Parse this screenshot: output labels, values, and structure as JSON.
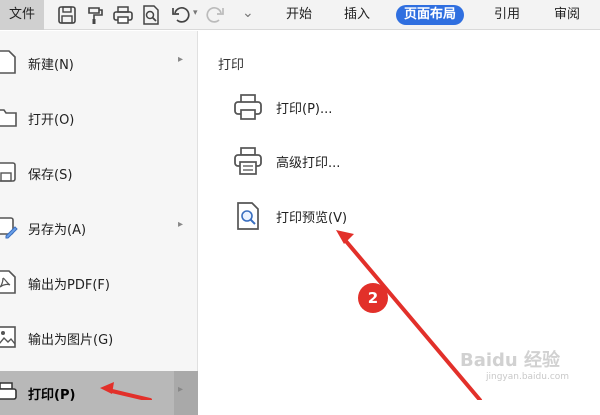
{
  "toolbar": {
    "file_menu_label": "文件",
    "tabs": [
      {
        "label": "开始",
        "active": false
      },
      {
        "label": "插入",
        "active": false
      },
      {
        "label": "页面布局",
        "active": true
      },
      {
        "label": "引用",
        "active": false
      },
      {
        "label": "审阅",
        "active": false
      }
    ],
    "quick_icons": [
      "save-icon",
      "format-painter-icon",
      "print-icon",
      "print-preview-icon",
      "undo-icon",
      "redo-icon",
      "customize-icon"
    ],
    "accent_color": "#2f6fe0"
  },
  "file_menu": {
    "items": [
      {
        "label": "新建(N)",
        "icon": "new-file-icon",
        "has_submenu": true,
        "selected": false
      },
      {
        "label": "打开(O)",
        "icon": "open-folder-icon",
        "has_submenu": false,
        "selected": false
      },
      {
        "label": "保存(S)",
        "icon": "save-icon",
        "has_submenu": false,
        "selected": false
      },
      {
        "label": "另存为(A)",
        "icon": "save-as-icon",
        "has_submenu": true,
        "selected": false
      },
      {
        "label": "输出为PDF(F)",
        "icon": "pdf-icon",
        "has_submenu": false,
        "selected": false
      },
      {
        "label": "输出为图片(G)",
        "icon": "image-icon",
        "has_submenu": false,
        "selected": false
      },
      {
        "label": "打印(P)",
        "icon": "print-icon",
        "has_submenu": true,
        "selected": true
      }
    ]
  },
  "print_panel": {
    "title": "打印",
    "options": [
      {
        "label": "打印(P)...",
        "icon": "printer-icon"
      },
      {
        "label": "高级打印...",
        "icon": "advanced-print-icon"
      },
      {
        "label": "打印预览(V)",
        "icon": "print-preview-icon"
      }
    ]
  },
  "annotation": {
    "step_number": "2",
    "badge_color": "#e2302a",
    "watermark": "Baidu 经验",
    "watermark_sub": "jingyan.baidu.com"
  }
}
